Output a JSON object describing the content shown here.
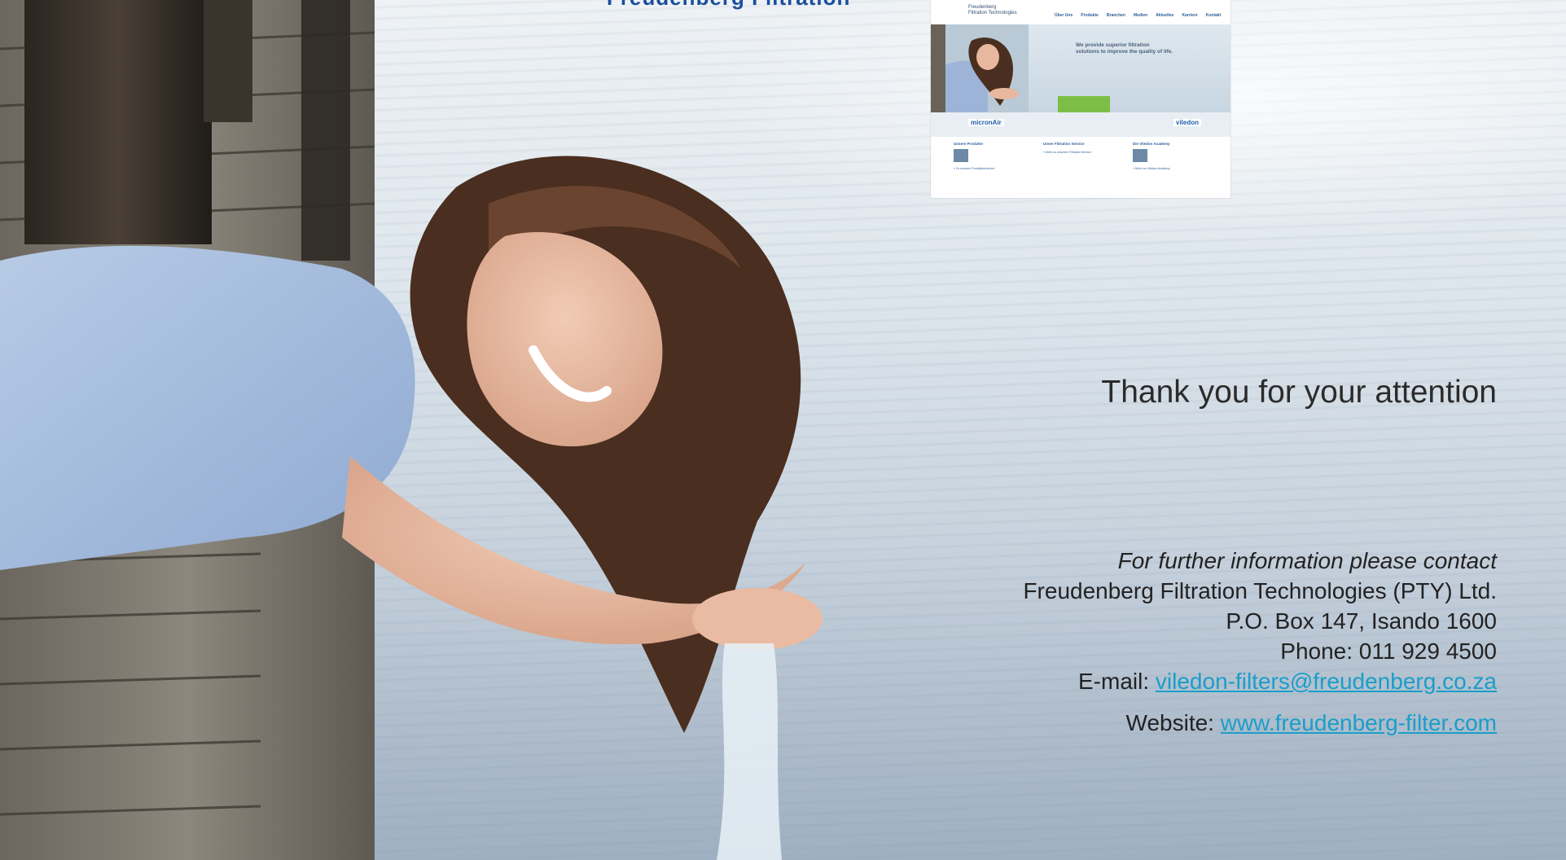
{
  "slide": {
    "top_heading": "Freudenberg Filtration",
    "thanks": "Thank you for your attention"
  },
  "contact": {
    "lead": "For further information please contact",
    "company": "Freudenberg Filtration Technologies (PTY) Ltd.",
    "address": "P.O. Box 147, Isando 1600",
    "phone": "Phone: 011 929 4500",
    "email_label": "E-mail:",
    "email": "viledon-filters@freudenberg.co.za",
    "website_label": "Website:",
    "website": "www.freudenberg-filter.com"
  },
  "thumbnail": {
    "logo_line1": "Freudenberg",
    "logo_line2": "Filtration Technologies",
    "nav": [
      "Über Uns",
      "Produkte",
      "Branchen",
      "Medien",
      "Aktuelles",
      "Karriere",
      "Kontakt"
    ],
    "tagline": "We provide superior filtration solutions to improve the quality of life.",
    "brand_left": "micronAir",
    "brand_right": "viledon",
    "columns": [
      {
        "heading": "Unsere Produkte",
        "link": "» Zu unseren Produktbereichen"
      },
      {
        "heading": "Unser Filtration Service",
        "link": "» Mehr zu unserem Filtration Service"
      },
      {
        "heading": "Die Viledon Academy",
        "link": "» Mehr zur Viledon Academy"
      }
    ]
  },
  "colors": {
    "heading_blue": "#1b4f9c",
    "link_cyan": "#1a9ec9",
    "text_dark": "#222222"
  }
}
